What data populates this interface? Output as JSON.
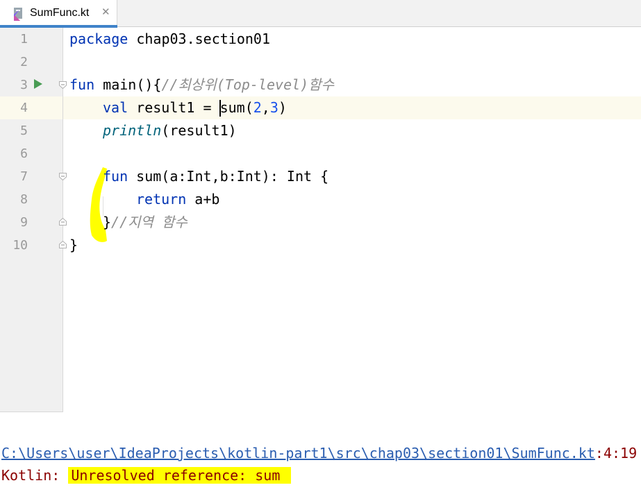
{
  "tab": {
    "filename": "SumFunc.kt",
    "close_glyph": "✕",
    "icon": "kotlin-file-icon"
  },
  "gutter": {
    "line_numbers": [
      "1",
      "2",
      "3",
      "4",
      "5",
      "6",
      "7",
      "8",
      "9",
      "10"
    ],
    "run_icon": "run-triangle-icon"
  },
  "code": {
    "l1_kw": "package",
    "l1_rest": " chap03.section01",
    "l3_kw": "fun",
    "l3_name": " main(){",
    "l3_comment": "//최상위(Top-level)함수",
    "l4_kw": "val",
    "l4_a": " result1 = ",
    "l4_b": "sum(",
    "l4_n1": "2",
    "l4_c": ",",
    "l4_n2": "3",
    "l4_d": ")",
    "l5_fn": "println",
    "l5_rest": "(result1)",
    "l7_kw": "fun",
    "l7_rest": " sum(a:Int,b:Int): Int {",
    "l8_kw": "return",
    "l8_rest": " a+b",
    "l9_brace": "}",
    "l9_comment": "//지역 함수",
    "l10_brace": "}"
  },
  "console": {
    "path": "C:\\Users\\user\\IdeaProjects\\kotlin-part1\\src\\chap03\\section01\\SumFunc.kt",
    "position": ":4:19",
    "error_prefix": "Kotlin: ",
    "error_message": "Unresolved reference: sum"
  },
  "colors": {
    "keyword": "#0033b3",
    "comment": "#8c8c8c",
    "number": "#1750eb",
    "error": "#8b0000",
    "highlight": "#ffff00",
    "tab_accent": "#4083c9"
  }
}
